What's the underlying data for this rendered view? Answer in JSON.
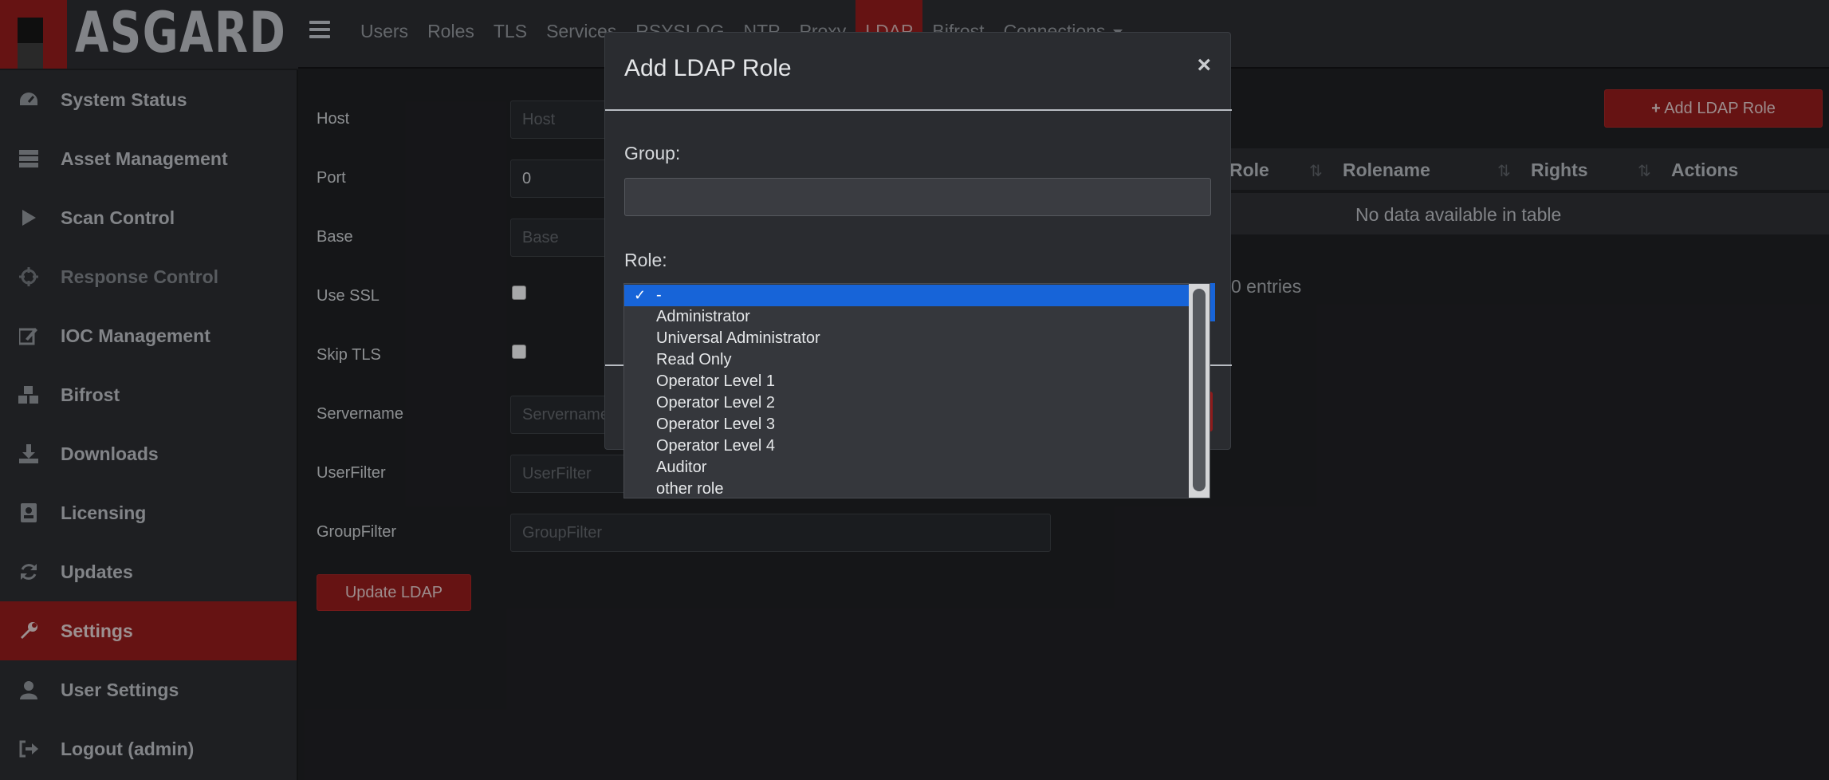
{
  "brand": {
    "name": "ASGARD"
  },
  "topnav": {
    "items": [
      "Users",
      "Roles",
      "TLS",
      "Services",
      "RSYSLOG",
      "NTP",
      "Proxy",
      "LDAP",
      "Bifrost",
      "Connections"
    ],
    "active": "LDAP"
  },
  "sidebar": {
    "items": [
      {
        "label": "System Status",
        "icon": "dashboard-icon"
      },
      {
        "label": "Asset Management",
        "icon": "server-icon"
      },
      {
        "label": "Scan Control",
        "icon": "play-icon"
      },
      {
        "label": "Response Control",
        "icon": "crosshair-icon"
      },
      {
        "label": "IOC Management",
        "icon": "edit-icon"
      },
      {
        "label": "Bifrost",
        "icon": "cubes-icon"
      },
      {
        "label": "Downloads",
        "icon": "download-icon"
      },
      {
        "label": "Licensing",
        "icon": "id-card-icon"
      },
      {
        "label": "Updates",
        "icon": "refresh-icon"
      },
      {
        "label": "Settings",
        "icon": "wrench-icon"
      },
      {
        "label": "User Settings",
        "icon": "user-icon"
      },
      {
        "label": "Logout (admin)",
        "icon": "logout-icon"
      }
    ],
    "active": "Settings"
  },
  "ldap_form": {
    "host": {
      "label": "Host",
      "placeholder": "Host"
    },
    "port": {
      "label": "Port",
      "value": "0"
    },
    "base": {
      "label": "Base",
      "placeholder": "Base"
    },
    "use_ssl": {
      "label": "Use SSL",
      "checked": false
    },
    "skip_tls": {
      "label": "Skip TLS",
      "checked": false
    },
    "servername": {
      "label": "Servername",
      "placeholder": "Servername"
    },
    "userfilter": {
      "label": "UserFilter",
      "placeholder": "UserFilter"
    },
    "groupfilter": {
      "label": "GroupFilter",
      "placeholder": "GroupFilter"
    },
    "update_button": "Update LDAP"
  },
  "roles_table": {
    "add_button": "Add LDAP Role",
    "columns": [
      "Role",
      "Rolename",
      "Rights",
      "Actions"
    ],
    "empty_message": "No data available in table",
    "entries_text": "0 entries"
  },
  "modal": {
    "title": "Add LDAP Role",
    "close": "×",
    "group_label": "Group:",
    "group_value": "",
    "role_label": "Role:",
    "role_options": [
      "-",
      "Administrator",
      "Universal Administrator",
      "Read Only",
      "Operator Level 1",
      "Operator Level 2",
      "Operator Level 3",
      "Operator Level 4",
      "Auditor",
      "other role"
    ],
    "role_selected": "-"
  },
  "colors": {
    "accent": "#8e1b1b",
    "select_highlight": "#1764d8",
    "background": "#1e1f22",
    "panel": "#2a2c30"
  }
}
